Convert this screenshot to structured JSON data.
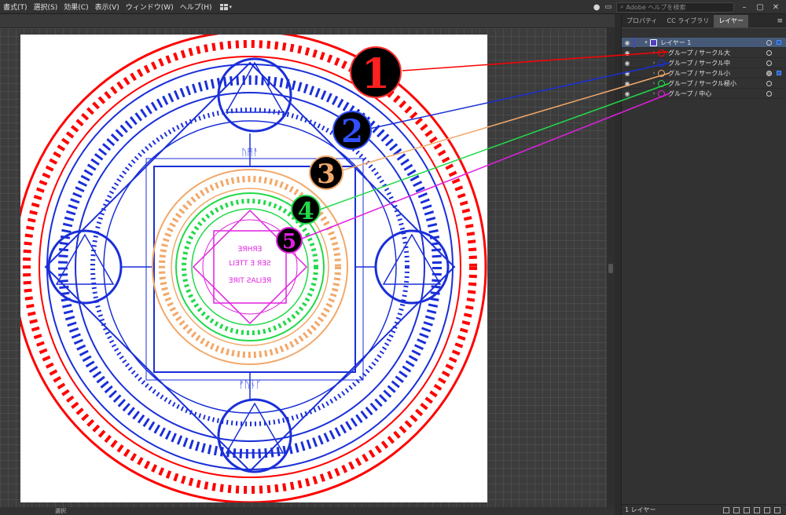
{
  "menubar": {
    "items": [
      "書式(T)",
      "選択(S)",
      "効果(C)",
      "表示(V)",
      "ウィンドウ(W)",
      "ヘルプ(H)"
    ],
    "search_placeholder": "Adobe ヘルプを検索"
  },
  "panel": {
    "tabs": [
      "プロパティ",
      "CC ライブラリ",
      "レイヤー"
    ],
    "active_tab": "レイヤー",
    "layers": [
      {
        "name": "レイヤー 1",
        "color": "#4f3fbf"
      },
      {
        "name": "グループ / サークル大",
        "color": "#ff0000"
      },
      {
        "name": "グループ / サークル中",
        "color": "#1a2fd8"
      },
      {
        "name": "グループ / サークル小",
        "color": "#f2a86a"
      },
      {
        "name": "グループ / サークル極小",
        "color": "#22d94a"
      },
      {
        "name": "グループ / 中心",
        "color": "#e020e0"
      }
    ],
    "footer_count": "1 レイヤー"
  },
  "statusbar": {
    "zoom": "",
    "tool": "選択"
  },
  "artwork": {
    "center_text_lines": [
      "ƎЯIT ƧALIƎЯ",
      "LIƎTT Ǝ ЯƎƧ",
      "ƎЯHЯƎ"
    ],
    "rune_top": "ᚢᛗᚨ",
    "rune_bottom": "ᚠᚢᚾᚴ",
    "markers": [
      "1",
      "2",
      "3",
      "4",
      "5"
    ],
    "colors": {
      "circle_large": "#ff0000",
      "circle_medium": "#1a2fd8",
      "circle_small": "#f2a86a",
      "circle_tiny": "#22d94a",
      "center": "#e020e0"
    }
  }
}
